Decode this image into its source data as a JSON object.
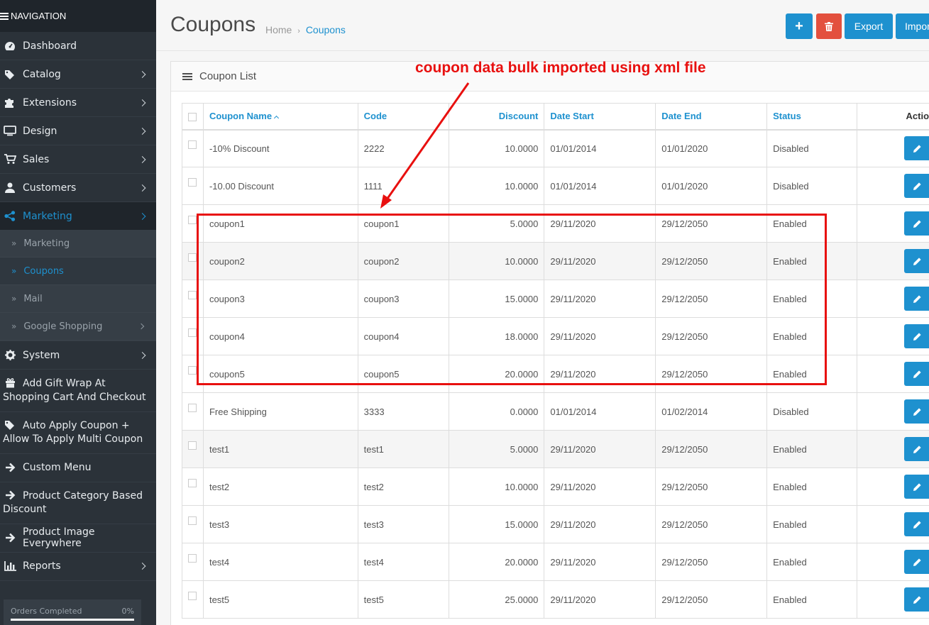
{
  "sidebar": {
    "header": "NAVIGATION",
    "items": [
      {
        "label": "Dashboard",
        "icon": "dashboard-icon"
      },
      {
        "label": "Catalog",
        "icon": "tags-icon"
      },
      {
        "label": "Extensions",
        "icon": "puzzle-icon"
      },
      {
        "label": "Design",
        "icon": "monitor-icon"
      },
      {
        "label": "Sales",
        "icon": "cart-icon"
      },
      {
        "label": "Customers",
        "icon": "user-icon"
      },
      {
        "label": "Marketing",
        "icon": "share-icon"
      },
      {
        "label": "System",
        "icon": "gear-icon"
      },
      {
        "label": "Add Gift Wrap At Shopping Cart And Checkout",
        "icon": "gift-icon"
      },
      {
        "label": "Auto Apply Coupon + Allow To Apply Multi Coupon",
        "icon": "tag-icon"
      },
      {
        "label": "Custom Menu",
        "icon": "arrow-right-icon"
      },
      {
        "label": "Product Category Based Discount",
        "icon": "arrow-right-icon"
      },
      {
        "label": "Product Image Everywhere",
        "icon": "arrow-right-icon"
      },
      {
        "label": "Reports",
        "icon": "bar-chart-icon"
      }
    ],
    "marketing_sub": [
      "Marketing",
      "Coupons",
      "Mail",
      "Google Shopping"
    ],
    "progress": {
      "label": "Orders Completed",
      "value": "0%"
    }
  },
  "header": {
    "title": "Coupons",
    "breadcrumb": {
      "home": "Home",
      "sep": "›",
      "current": "Coupons"
    },
    "buttons": {
      "add": "+",
      "export": "Export",
      "import": "Import"
    }
  },
  "panel": {
    "title": "Coupon List",
    "columns": [
      "Coupon Name",
      "Code",
      "Discount",
      "Date Start",
      "Date End",
      "Status",
      "Action"
    ],
    "rows": [
      [
        "-10% Discount",
        "2222",
        "10.0000",
        "01/01/2014",
        "01/01/2020",
        "Disabled"
      ],
      [
        "-10.00 Discount",
        "1111",
        "10.0000",
        "01/01/2014",
        "01/01/2020",
        "Disabled"
      ],
      [
        "coupon1",
        "coupon1",
        "5.0000",
        "29/11/2020",
        "29/12/2050",
        "Enabled"
      ],
      [
        "coupon2",
        "coupon2",
        "10.0000",
        "29/11/2020",
        "29/12/2050",
        "Enabled"
      ],
      [
        "coupon3",
        "coupon3",
        "15.0000",
        "29/11/2020",
        "29/12/2050",
        "Enabled"
      ],
      [
        "coupon4",
        "coupon4",
        "18.0000",
        "29/11/2020",
        "29/12/2050",
        "Enabled"
      ],
      [
        "coupon5",
        "coupon5",
        "20.0000",
        "29/11/2020",
        "29/12/2050",
        "Enabled"
      ],
      [
        "Free Shipping",
        "3333",
        "0.0000",
        "01/01/2014",
        "01/02/2014",
        "Disabled"
      ],
      [
        "test1",
        "test1",
        "5.0000",
        "29/11/2020",
        "29/12/2050",
        "Enabled"
      ],
      [
        "test2",
        "test2",
        "10.0000",
        "29/11/2020",
        "29/12/2050",
        "Enabled"
      ],
      [
        "test3",
        "test3",
        "15.0000",
        "29/11/2020",
        "29/12/2050",
        "Enabled"
      ],
      [
        "test4",
        "test4",
        "20.0000",
        "29/11/2020",
        "29/12/2050",
        "Enabled"
      ],
      [
        "test5",
        "test5",
        "25.0000",
        "29/11/2020",
        "29/12/2050",
        "Enabled"
      ]
    ]
  },
  "annotation": {
    "text": "coupon data bulk imported using xml file",
    "color": "#e8100f"
  },
  "colors": {
    "accent": "#1e91cf",
    "danger": "#e3503e",
    "sidebar": "#2b3239"
  }
}
